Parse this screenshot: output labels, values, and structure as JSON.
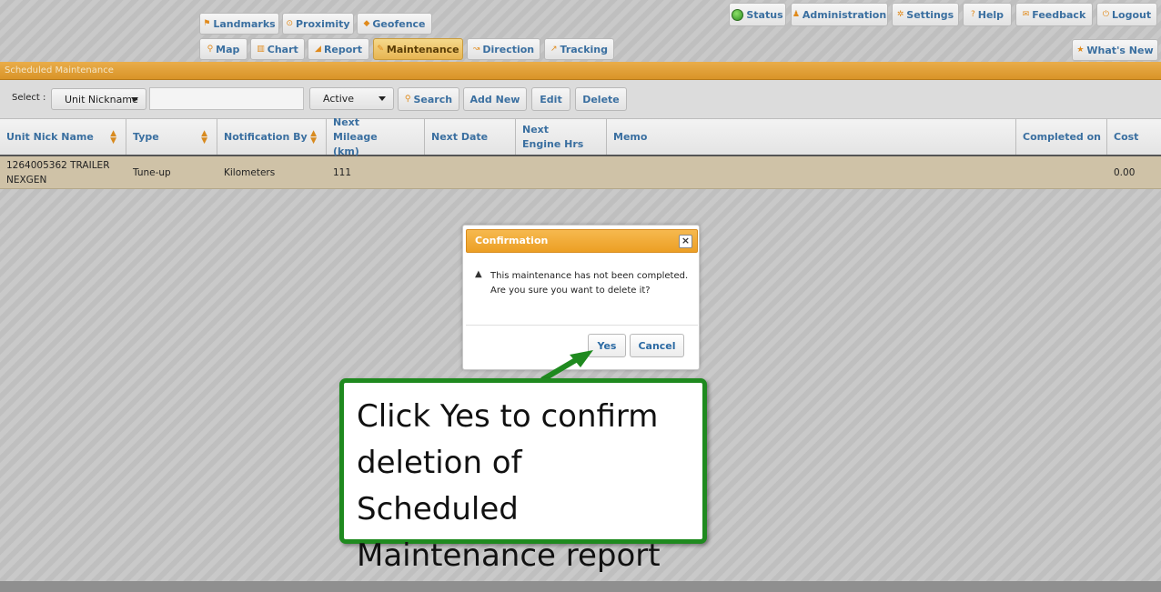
{
  "nav": {
    "row1": [
      {
        "label": "Landmarks"
      },
      {
        "label": "Proximity"
      },
      {
        "label": "Geofence"
      }
    ],
    "row2": [
      {
        "label": "Map"
      },
      {
        "label": "Chart"
      },
      {
        "label": "Report"
      },
      {
        "label": "Maintenance",
        "active": true
      },
      {
        "label": "Direction"
      },
      {
        "label": "Tracking"
      }
    ]
  },
  "top_menu": {
    "status": "Status",
    "administration": "Administration",
    "settings": "Settings",
    "help": "Help",
    "feedback": "Feedback",
    "logout": "Logout",
    "whats_new": "What's New"
  },
  "panel_title": "Scheduled Maintenance",
  "toolbar": {
    "select_label": "Select :",
    "unit_dropdown": "Unit Nickname",
    "search_value": "",
    "status_dropdown": "Active",
    "search_button": "Search",
    "add_button": "Add New",
    "edit_button": "Edit",
    "delete_button": "Delete"
  },
  "table": {
    "columns": [
      "Unit Nick Name",
      "Type",
      "Notification By",
      "Next Mileage (km)",
      "Next Date",
      "Next Engine Hrs",
      "Memo",
      "Completed on",
      "Cost"
    ],
    "rows": [
      {
        "unit": "1264005362 TRAILER NEXGEN",
        "type": "Tune-up",
        "notification_by": "Kilometers",
        "next_mileage": "111",
        "next_date": "",
        "next_engine_hrs": "",
        "memo": "",
        "completed_on": "",
        "cost": "0.00"
      }
    ]
  },
  "dialog": {
    "title": "Confirmation",
    "close": "×",
    "message_line1": "This maintenance has not been completed.",
    "message_line2": "Are you sure you want to delete it?",
    "yes": "Yes",
    "cancel": "Cancel"
  },
  "callout": {
    "line1": "Click Yes to confirm",
    "line2": "deletion of Scheduled",
    "line3": "Maintenance report"
  },
  "colors": {
    "accent_orange": "#ec9f24",
    "link_blue": "#3a6fa0",
    "callout_green": "#1f8a1f",
    "row_highlight": "#cfc2a7"
  },
  "icons": {
    "landmarks": "flag-icon",
    "proximity": "proximity-icon",
    "geofence": "geofence-icon",
    "map": "map-icon",
    "chart": "chart-icon",
    "report": "report-icon",
    "maintenance": "wrench-icon",
    "direction": "direction-icon",
    "tracking": "tracking-icon",
    "status": "status-dot-icon",
    "administration": "user-icon",
    "settings": "gear-icon",
    "help": "help-icon",
    "feedback": "feedback-icon",
    "logout": "power-icon",
    "whats_new": "star-icon",
    "search": "search-icon",
    "warning": "warning-icon",
    "close": "close-icon"
  }
}
